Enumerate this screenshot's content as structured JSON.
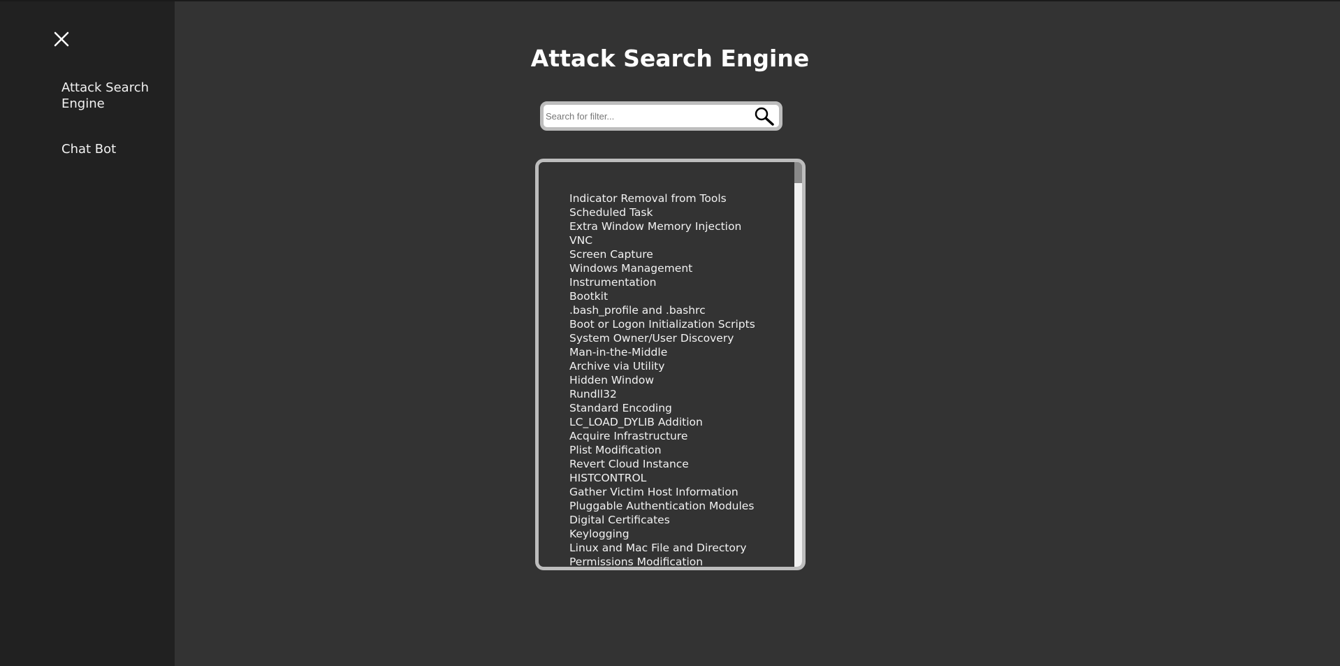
{
  "sidebar": {
    "close_icon": "close-icon",
    "items": [
      {
        "label": "Attack Search Engine"
      },
      {
        "label": "Chat Bot"
      }
    ]
  },
  "main": {
    "title": "Attack Search Engine",
    "search": {
      "placeholder": "Search for filter...",
      "value": "",
      "icon": "search-icon"
    },
    "results": [
      "Indicator Removal from Tools",
      "Scheduled Task",
      "Extra Window Memory Injection",
      "VNC",
      "Screen Capture",
      "Windows Management",
      "Instrumentation",
      "Bootkit",
      ".bash_profile and .bashrc",
      "Boot or Logon Initialization Scripts",
      "System Owner/User Discovery",
      "Man-in-the-Middle",
      "Archive via Utility",
      "Hidden Window",
      "Rundll32",
      "Standard Encoding",
      "LC_LOAD_DYLIB Addition",
      "Acquire Infrastructure",
      "Plist Modification",
      "Revert Cloud Instance",
      "HISTCONTROL",
      "Gather Victim Host Information",
      "Pluggable Authentication Modules",
      "Digital Certificates",
      "Keylogging",
      "Linux and Mac File and Directory",
      "Permissions Modification"
    ]
  },
  "colors": {
    "page_background": "#333333",
    "sidebar_background": "#212121",
    "text": "#f2f2f2",
    "border": "#bdbdbd"
  }
}
